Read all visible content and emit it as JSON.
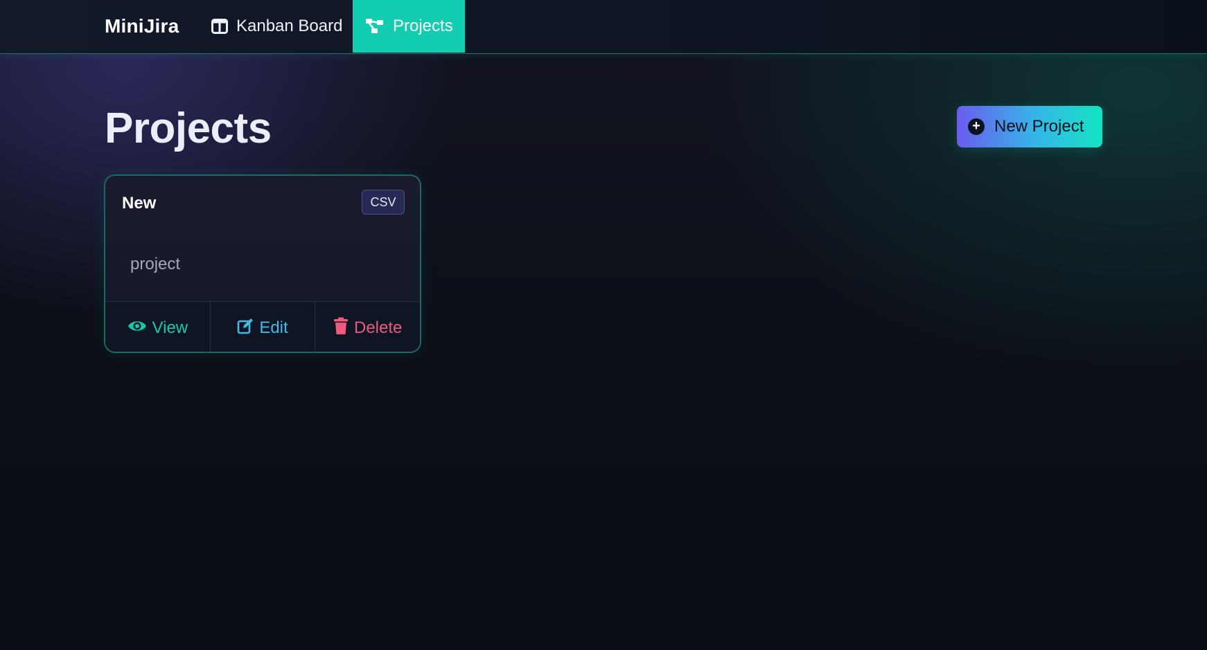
{
  "navbar": {
    "brand": "MiniJira",
    "links": [
      {
        "label": "Kanban Board",
        "icon": "columns-icon",
        "active": false
      },
      {
        "label": "Projects",
        "icon": "sitemap-icon",
        "active": true
      }
    ],
    "active_color": "#12cdb0"
  },
  "main": {
    "title": "Projects",
    "new_button": {
      "label": "New Project",
      "icon": "plus-circle-icon"
    }
  },
  "projects": [
    {
      "name": "New",
      "badge": "CSV",
      "description": "project",
      "actions": {
        "view": "View",
        "edit": "Edit",
        "delete": "Delete"
      }
    }
  ],
  "colors": {
    "view": "#15c9ad",
    "edit": "#45b9e8",
    "delete": "#ee5a7d"
  }
}
